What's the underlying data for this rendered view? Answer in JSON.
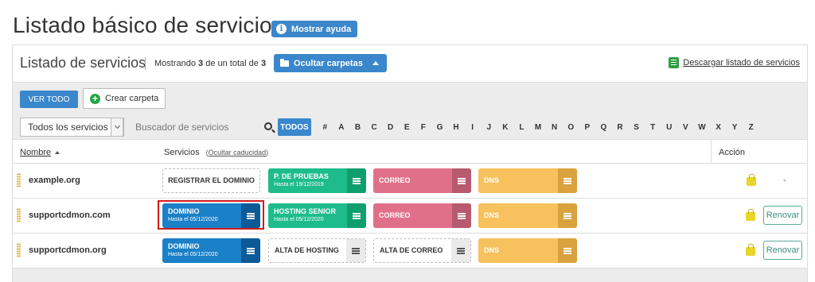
{
  "page": {
    "title": "Listado básico de servicios",
    "help_button": "Mostrar ayuda"
  },
  "panel": {
    "title": "Listado de servicios",
    "count_prefix": "Mostrando ",
    "count_shown": "3",
    "count_middle": " de un total de ",
    "count_total": "3",
    "folders_button": "Ocultar carpetas",
    "download_link": "Descargar listado de servicios"
  },
  "toolbar": {
    "ver_todo": "VER TODO",
    "crear_carpeta": "Crear carpeta",
    "filter_select": "Todos los servicios",
    "search_placeholder": "Buscador de servicios",
    "todos": "TODOS",
    "letters": [
      "#",
      "A",
      "B",
      "C",
      "D",
      "E",
      "F",
      "G",
      "H",
      "I",
      "J",
      "K",
      "L",
      "M",
      "N",
      "O",
      "P",
      "Q",
      "R",
      "S",
      "T",
      "U",
      "V",
      "W",
      "X",
      "Y",
      "Z"
    ]
  },
  "table": {
    "col_name": "Nombre",
    "col_services": "Servicios",
    "col_services_toggle": "Ocultar caducidad",
    "col_action": "Acción",
    "rows": [
      {
        "domain": "example.org",
        "services": [
          {
            "label": "REGISTRAR EL DOMINIO",
            "sub": ""
          },
          {
            "label": "P. DE PRUEBAS",
            "sub": "Hasta el 19/12/2019"
          },
          {
            "label": "CORREO",
            "sub": ""
          },
          {
            "label": "DNS",
            "sub": ""
          }
        ],
        "action": "-"
      },
      {
        "domain": "supportcdmon.com",
        "services": [
          {
            "label": "DOMINIO",
            "sub": "Hasta el 05/12/2020"
          },
          {
            "label": "HOSTING SENIOR",
            "sub": "Hasta el 05/12/2020"
          },
          {
            "label": "CORREO",
            "sub": ""
          },
          {
            "label": "DNS",
            "sub": ""
          }
        ],
        "action": "Renovar"
      },
      {
        "domain": "supportcdmon.org",
        "services": [
          {
            "label": "DOMINIO",
            "sub": "Hasta el 05/12/2020"
          },
          {
            "label": "ALTA DE HOSTING",
            "sub": ""
          },
          {
            "label": "ALTA DE CORREO",
            "sub": ""
          },
          {
            "label": "DNS",
            "sub": ""
          }
        ],
        "action": "Renovar"
      }
    ]
  },
  "colors": {
    "primary": "#3a87cc",
    "hosting": "#1ebc8a",
    "correo": "#e0708a",
    "dns": "#f7c15d",
    "dominio": "#1a80c8",
    "highlight": "#d11a1a"
  }
}
